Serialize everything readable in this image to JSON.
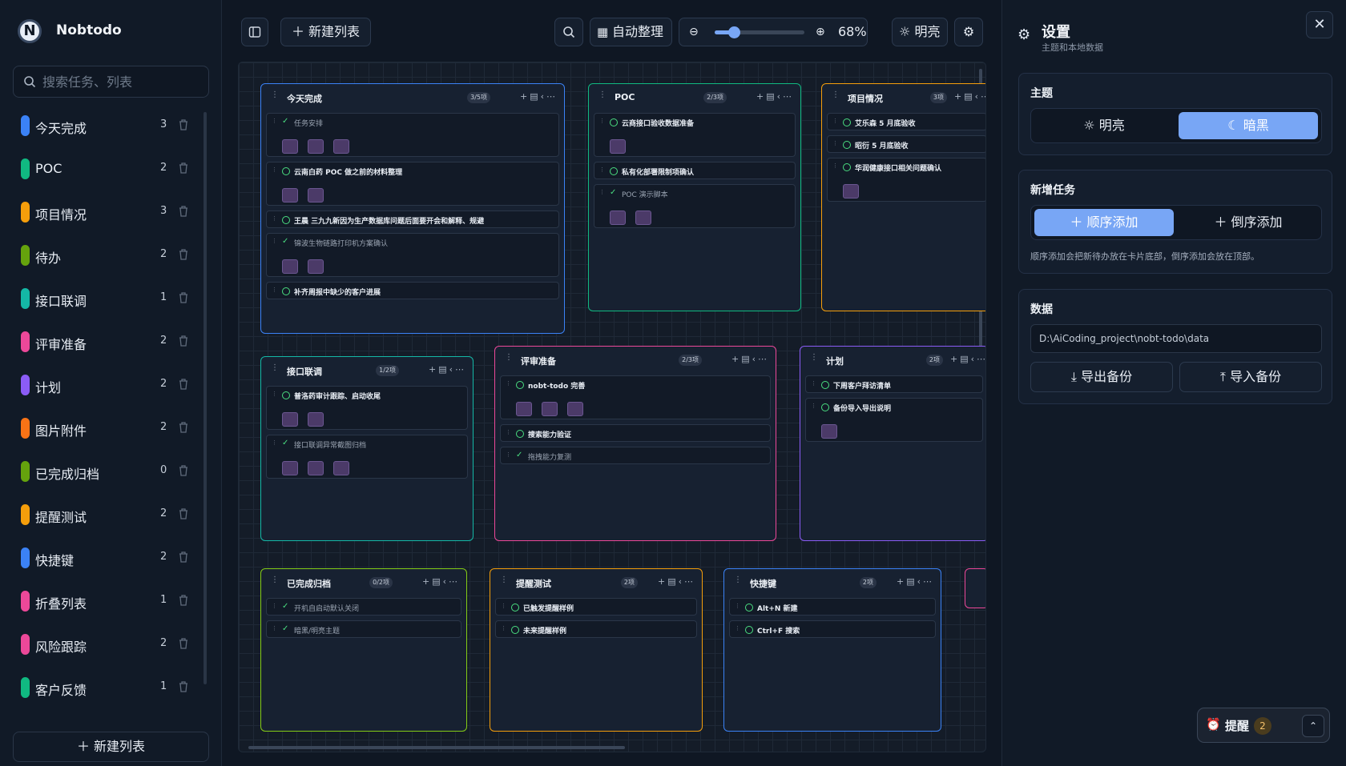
{
  "app": {
    "title": "Nobtodo",
    "logo_letter": "N"
  },
  "sidebar": {
    "search_placeholder": "搜索任务、列表",
    "new_list_label": "新建列表",
    "items": [
      {
        "label": "今天完成",
        "count": "3",
        "color": "#3b82f6"
      },
      {
        "label": "POC",
        "count": "2",
        "color": "#10b981"
      },
      {
        "label": "项目情况",
        "count": "3",
        "color": "#f59e0b"
      },
      {
        "label": "待办",
        "count": "2",
        "color": "#65a30d"
      },
      {
        "label": "接口联调",
        "count": "1",
        "color": "#14b8a6"
      },
      {
        "label": "评审准备",
        "count": "2",
        "color": "#ec4899"
      },
      {
        "label": "计划",
        "count": "2",
        "color": "#8b5cf6"
      },
      {
        "label": "图片附件",
        "count": "2",
        "color": "#f97316"
      },
      {
        "label": "已完成归档",
        "count": "0",
        "color": "#65a30d"
      },
      {
        "label": "提醒测试",
        "count": "2",
        "color": "#f59e0b"
      },
      {
        "label": "快捷键",
        "count": "2",
        "color": "#3b82f6"
      },
      {
        "label": "折叠列表",
        "count": "1",
        "color": "#ec4899"
      },
      {
        "label": "风险跟踪",
        "count": "2",
        "color": "#ec4899"
      },
      {
        "label": "客户反馈",
        "count": "1",
        "color": "#10b981"
      }
    ]
  },
  "toolbar": {
    "new_list_label": "新建列表",
    "auto_arrange_label": "自动整理",
    "zoom_value": "68%",
    "zoom_fraction": 0.68,
    "theme_label": "明亮"
  },
  "cards": [
    {
      "title": "今天完成",
      "badge": "3/5项",
      "color": "#3b82f6",
      "tasks": [
        {
          "text": "任务安排",
          "done": true,
          "attachments": 3
        },
        {
          "text": "云南白药 POC 做之前的材料整理",
          "done": false,
          "attachments": 2
        },
        {
          "text": "王晨 三九九新因为生产数据库问题后面要开会和解释、规避",
          "done": false,
          "attachments": 0
        },
        {
          "text": "锦波生物链路打印机方案确认",
          "done": true,
          "attachments": 2
        },
        {
          "text": "补齐周报中缺少的客户进展",
          "done": false,
          "attachments": 0
        }
      ]
    },
    {
      "title": "POC",
      "badge": "2/3项",
      "color": "#10b981",
      "tasks": [
        {
          "text": "云商接口验收数据准备",
          "done": false,
          "attachments": 1
        },
        {
          "text": "私有化部署限制项确认",
          "done": false,
          "attachments": 0
        },
        {
          "text": "POC 演示脚本",
          "done": true,
          "attachments": 2
        }
      ]
    },
    {
      "title": "项目情况",
      "badge": "3项",
      "color": "#f59e0b",
      "tasks": [
        {
          "text": "艾乐森 5 月底验收",
          "done": false,
          "attachments": 0
        },
        {
          "text": "昭衍 5 月底验收",
          "done": false,
          "attachments": 0
        },
        {
          "text": "华润健康接口相关问题确认",
          "done": false,
          "attachments": 1
        }
      ]
    },
    {
      "title": "接口联调",
      "badge": "1/2项",
      "color": "#14b8a6",
      "tasks": [
        {
          "text": "普洛药审计跟踪、启动收尾",
          "done": false,
          "attachments": 2
        },
        {
          "text": "接口联调异常截图归档",
          "done": true,
          "attachments": 3
        }
      ]
    },
    {
      "title": "评审准备",
      "badge": "2/3项",
      "color": "#ec4899",
      "tasks": [
        {
          "text": "nobt-todo 完善",
          "done": false,
          "attachments": 3
        },
        {
          "text": "搜索能力验证",
          "done": false,
          "attachments": 0
        },
        {
          "text": "拖拽能力复测",
          "done": true,
          "attachments": 0
        }
      ]
    },
    {
      "title": "计划",
      "badge": "2项",
      "color": "#8b5cf6",
      "tasks": [
        {
          "text": "下周客户拜访清单",
          "done": false,
          "attachments": 0
        },
        {
          "text": "备份导入导出说明",
          "done": false,
          "attachments": 1
        }
      ]
    },
    {
      "title": "已完成归档",
      "badge": "0/2项",
      "color": "#84cc16",
      "tasks": [
        {
          "text": "开机自启动默认关闭",
          "done": true,
          "attachments": 0
        },
        {
          "text": "暗黑/明亮主题",
          "done": true,
          "attachments": 0
        }
      ]
    },
    {
      "title": "提醒测试",
      "badge": "2项",
      "color": "#f59e0b",
      "tasks": [
        {
          "text": "已触发提醒样例",
          "done": false,
          "attachments": 0
        },
        {
          "text": "未来提醒样例",
          "done": false,
          "attachments": 0
        }
      ]
    },
    {
      "title": "快捷键",
      "badge": "2项",
      "color": "#3b82f6",
      "tasks": [
        {
          "text": "Alt+N 新建",
          "done": false,
          "attachments": 0
        },
        {
          "text": "Ctrl+F 搜索",
          "done": false,
          "attachments": 0
        }
      ]
    }
  ],
  "settings": {
    "title": "设置",
    "subtitle": "主题和本地数据",
    "theme_heading": "主题",
    "theme_light": "明亮",
    "theme_dark": "暗黑",
    "new_task_heading": "新增任务",
    "append_label": "顺序添加",
    "prepend_label": "倒序添加",
    "new_task_hint": "顺序添加会把新待办放在卡片底部，倒序添加会放在顶部。",
    "data_heading": "数据",
    "data_path": "D:\\AiCoding_project\\nobt-todo\\data",
    "export_label": "导出备份",
    "import_label": "导入备份"
  },
  "reminder": {
    "label": "提醒",
    "count": "2"
  }
}
